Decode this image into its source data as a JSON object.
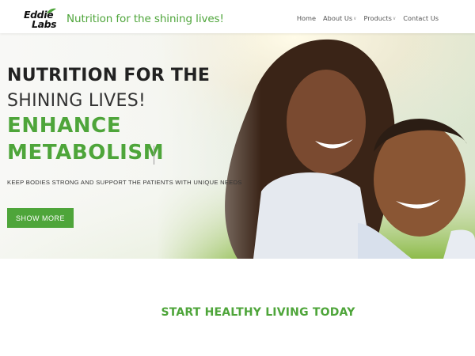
{
  "brand": {
    "logo_line1": "Eddie",
    "logo_line2": "Labs",
    "tagline": "Nutrition for the shining lives!",
    "accent_color": "#4ea53a"
  },
  "nav": {
    "items": [
      {
        "label": "Home",
        "has_dropdown": false
      },
      {
        "label": "About Us",
        "has_dropdown": true
      },
      {
        "label": "Products",
        "has_dropdown": true
      },
      {
        "label": "Contact Us",
        "has_dropdown": false
      }
    ],
    "caret_icon": "chevron-down-icon"
  },
  "hero": {
    "heading_line1": "NUTRITION FOR THE",
    "heading_line2": "SHINING LIVES!",
    "highlight_line1": "ENHANCE",
    "highlight_line2": "METABOLISM",
    "subtitle": "KEEP BODIES STRONG AND SUPPORT THE PATIENTS WITH UNIQUE NEEDS",
    "cta_label": "SHOW MORE"
  },
  "section": {
    "title": "START HEALTHY LIVING TODAY"
  }
}
